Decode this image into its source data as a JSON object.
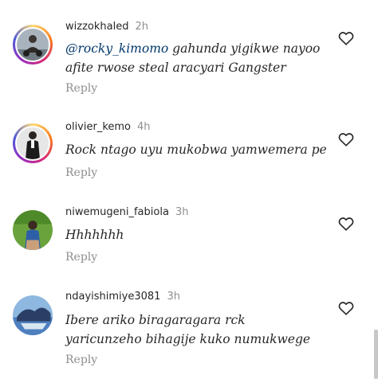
{
  "comments": [
    {
      "username": "wizzokhaled",
      "time": "2h",
      "mention": "@rocky_kimomo",
      "text_line1_rest": " gahunda yigikwe nayoo",
      "text_line2": "afite rwose steal aracyari Gangster",
      "reply_label": "Reply",
      "has_story_ring": true,
      "like_icon": "heart-outline-icon"
    },
    {
      "username": "olivier_kemo",
      "time": "4h",
      "text_line1": "Rock ntago uyu mukobwa yamwemera pe",
      "reply_label": "Reply",
      "has_story_ring": true,
      "like_icon": "heart-outline-icon"
    },
    {
      "username": "niwemugeni_fabiola",
      "time": "3h",
      "text_line1": "Hhhhhhh",
      "reply_label": "Reply",
      "has_story_ring": false,
      "like_icon": "heart-outline-icon"
    },
    {
      "username": "ndayishimiye3081",
      "time": "3h",
      "text_line1": "Ibere ariko biragaragara rck",
      "text_line2": "yaricunzeho  bihagije kuko numukwege",
      "reply_label": "Reply",
      "has_story_ring": false,
      "like_icon": "heart-outline-icon"
    }
  ],
  "colors": {
    "text": "#262626",
    "secondary": "#8e8e8e",
    "mention": "#00376b"
  }
}
